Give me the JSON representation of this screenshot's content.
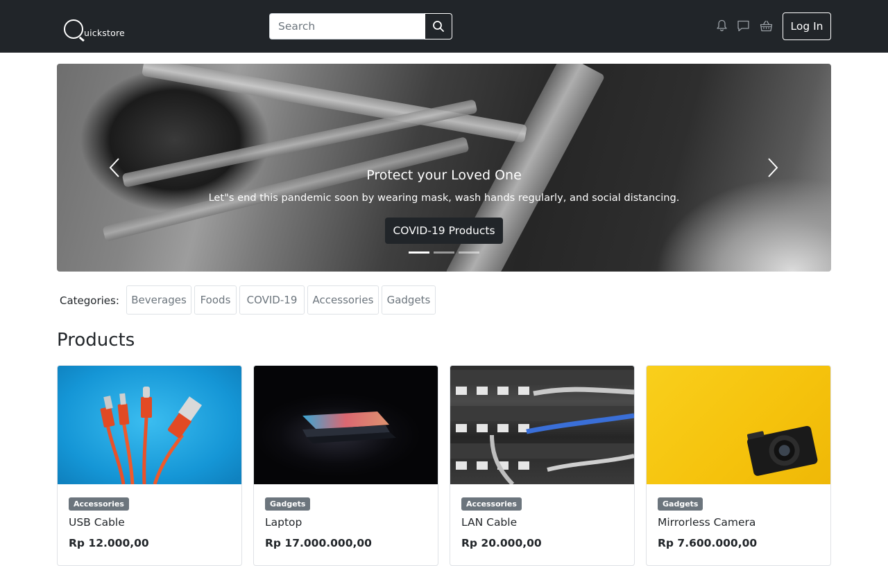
{
  "navbar": {
    "brand_text": "uickstore",
    "search_placeholder": "Search",
    "login_label": "Log In",
    "icons": [
      "search-icon",
      "bell-icon",
      "chat-icon",
      "basket-icon"
    ]
  },
  "carousel": {
    "title": "Protect your Loved One",
    "text": "Let\"s end this pandemic soon by wearing mask, wash hands regularly, and social distancing.",
    "cta_label": "COVID-19 Products",
    "slide_count": 3,
    "active_slide": 1
  },
  "categories": {
    "label": "Categories:",
    "items": [
      "Beverages",
      "Foods",
      "COVID-19",
      "Accessories",
      "Gadgets"
    ]
  },
  "products": {
    "heading": "Products",
    "items": [
      {
        "badge": "Accessories",
        "name": "USB Cable",
        "price": "Rp 12.000,00"
      },
      {
        "badge": "Gadgets",
        "name": "Laptop",
        "price": "Rp 17.000.000,00"
      },
      {
        "badge": "Accessories",
        "name": "LAN Cable",
        "price": "Rp 20.000,00"
      },
      {
        "badge": "Gadgets",
        "name": "Mirrorless Camera",
        "price": "Rp 7.600.000,00"
      }
    ]
  },
  "colors": {
    "navbar_bg": "#212529",
    "badge_bg": "#6c757d",
    "usb_bg": "#1ea7e0",
    "camera_bg": "#f8c814"
  }
}
